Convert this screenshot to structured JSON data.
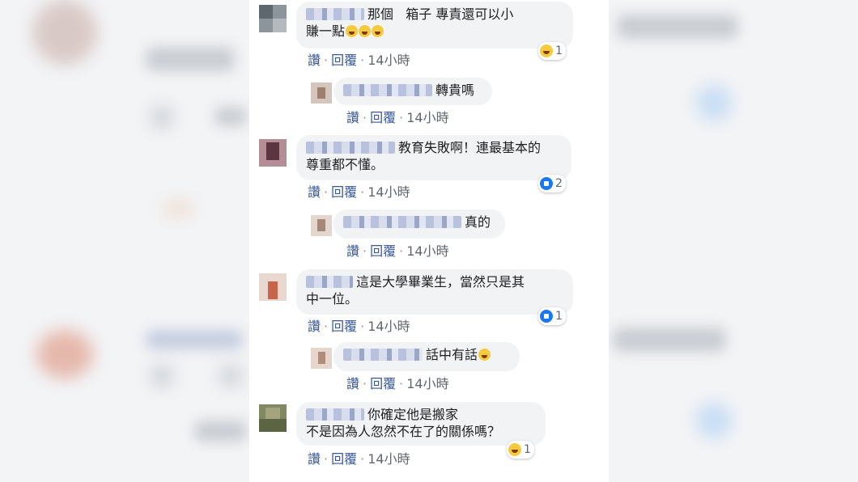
{
  "comments": [
    {
      "text": "那個   箱子 專責還可以小\n賺一點",
      "actions": {
        "like": "讚",
        "reply": "回覆",
        "time": "14小時"
      },
      "reaction": {
        "icon": "haha-icon",
        "count": "1"
      }
    },
    {
      "text": "轉貴嗎",
      "actions": {
        "like": "讚",
        "reply": "回覆",
        "time": "14小時"
      }
    },
    {
      "text": "教育失敗啊！連最基本的\n尊重都不懂。",
      "actions": {
        "like": "讚",
        "reply": "回覆",
        "time": "14小時"
      },
      "reaction": {
        "icon": "like-icon",
        "count": "2"
      }
    },
    {
      "text": "真的",
      "actions": {
        "like": "讚",
        "reply": "回覆",
        "time": "14小時"
      }
    },
    {
      "text": "這是大學畢業生，當然只是其\n中一位。",
      "actions": {
        "like": "讚",
        "reply": "回覆",
        "time": "14小時"
      },
      "reaction": {
        "icon": "like-icon",
        "count": "1"
      }
    },
    {
      "text": "話中有話",
      "actions": {
        "like": "讚",
        "reply": "回覆",
        "time": "14小時"
      }
    },
    {
      "text": "你確定他是搬家\n不是因為人忽然不在了的關係嗎？",
      "actions": {
        "like": "讚",
        "reply": "回覆",
        "time": "14小時"
      },
      "reaction": {
        "icon": "haha-icon",
        "count": "1"
      }
    }
  ],
  "colors": {
    "link": "#385898",
    "bubble": "#f2f3f5",
    "like": "#1877f2",
    "haha": "#f7c93c"
  }
}
